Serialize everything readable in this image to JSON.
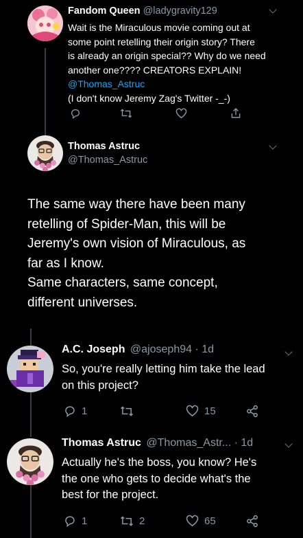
{
  "tweet1": {
    "name": "Fandom Queen",
    "handle": "@ladygravity129",
    "lines": [
      "Wait is the Miraculous movie coming out at",
      "some point retelling their origin story? There",
      "is already an origin special?? Why do we need",
      "another one???? CREATORS EXPLAIN!"
    ],
    "mention": "@Thomas_Astruc",
    "note": "(I don't know Jeremy Zag's Twitter -_-)"
  },
  "tweet2": {
    "name": "Thomas Astruc",
    "handle": "@Thomas_Astruc",
    "lines": [
      "The same way there have been many",
      "retelling of Spider-Man, this will be",
      "Jeremy's own vision of Miraculous, as",
      "far as I know.",
      "Same characters, same concept,",
      "different universes."
    ]
  },
  "tweet3": {
    "name": "A.C. Joseph",
    "meta": "@ajoseph94 · 1d",
    "lines": [
      "So, you're really letting him take the lead",
      "on this project?"
    ],
    "replies": "1",
    "retweets": "",
    "likes": "15"
  },
  "tweet4": {
    "name": "Thomas Astruc",
    "meta": "@Thomas_Astr... · 1d",
    "lines": [
      "Actually he's the boss, you know? He's",
      "the one who gets to decide what's the",
      "best for the project."
    ],
    "replies": "1",
    "retweets": "2",
    "likes": "65"
  },
  "colors": {
    "background": "#000000",
    "secondary_text": "#8899a6",
    "link": "#1da1f2",
    "thread_line": "#3a3d42"
  }
}
